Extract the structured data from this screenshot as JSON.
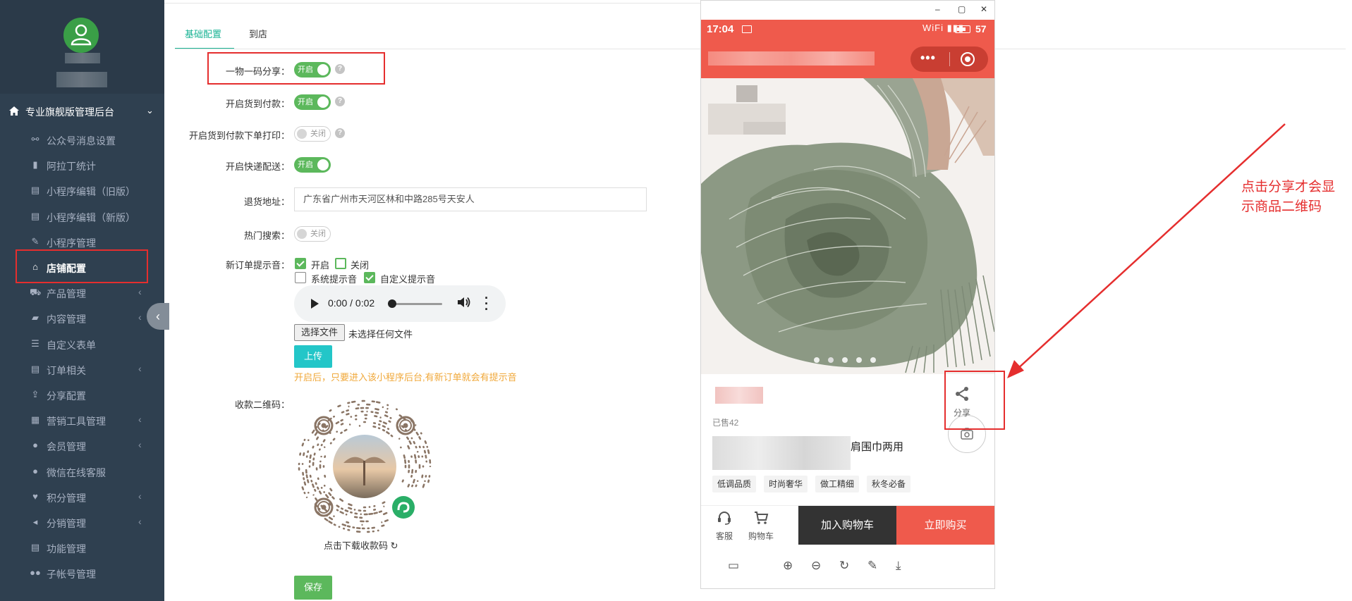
{
  "sidebar": {
    "header": {
      "label": "专业旗舰版管理后台",
      "icon": "home-icon",
      "chevron": "chevron-down-icon"
    },
    "items": [
      {
        "label": "公众号消息设置",
        "icon": "link-icon",
        "has_arrow": false,
        "active": false
      },
      {
        "label": "阿拉丁统计",
        "icon": "bar-chart-icon",
        "has_arrow": false,
        "active": false
      },
      {
        "label": "小程序编辑（旧版）",
        "icon": "book-icon",
        "has_arrow": false,
        "active": false
      },
      {
        "label": "小程序编辑（新版）",
        "icon": "book-icon",
        "has_arrow": false,
        "active": false
      },
      {
        "label": "小程序管理",
        "icon": "wrench-icon",
        "has_arrow": false,
        "active": false
      },
      {
        "label": "店铺配置",
        "icon": "home-icon",
        "has_arrow": false,
        "active": true
      },
      {
        "label": "产品管理",
        "icon": "cart-icon",
        "has_arrow": true,
        "active": false
      },
      {
        "label": "内容管理",
        "icon": "folder-icon",
        "has_arrow": true,
        "active": false
      },
      {
        "label": "自定义表单",
        "icon": "list-icon",
        "has_arrow": false,
        "active": false
      },
      {
        "label": "订单相关",
        "icon": "order-icon",
        "has_arrow": true,
        "active": false
      },
      {
        "label": "分享配置",
        "icon": "share-icon",
        "has_arrow": false,
        "active": false
      },
      {
        "label": "营销工具管理",
        "icon": "grid-icon",
        "has_arrow": true,
        "active": false
      },
      {
        "label": "会员管理",
        "icon": "user-icon",
        "has_arrow": true,
        "active": false
      },
      {
        "label": "微信在线客服",
        "icon": "user-icon",
        "has_arrow": false,
        "active": false
      },
      {
        "label": "积分管理",
        "icon": "heart-icon",
        "has_arrow": true,
        "active": false
      },
      {
        "label": "分销管理",
        "icon": "bullhorn-icon",
        "has_arrow": true,
        "active": false
      },
      {
        "label": "功能管理",
        "icon": "book-icon",
        "has_arrow": false,
        "active": false
      },
      {
        "label": "子帐号管理",
        "icon": "users-icon",
        "has_arrow": false,
        "active": false
      }
    ]
  },
  "tabs": [
    {
      "label": "基础配置",
      "active": true
    },
    {
      "label": "到店",
      "active": false
    }
  ],
  "form": {
    "share_one_code": {
      "label": "一物一码分享：",
      "toggle": "开启",
      "on": true
    },
    "cod": {
      "label": "开启货到付款：",
      "toggle": "开启",
      "on": true
    },
    "cod_print": {
      "label": "开启货到付款下单打印：",
      "toggle": "关闭",
      "on": false
    },
    "express": {
      "label": "开启快递配送：",
      "toggle": "开启",
      "on": true
    },
    "return_address": {
      "label": "退货地址：",
      "value": "广东省广州市天河区林和中路285号天安人"
    },
    "hot_search": {
      "label": "热门搜索：",
      "toggle": "关闭",
      "on": false
    },
    "order_sound": {
      "label": "新订单提示音：",
      "opt_on": "开启",
      "opt_off": "关闭",
      "opt_system": "系统提示音",
      "opt_custom": "自定义提示音",
      "audio_time": "0:00 / 0:02",
      "file_button": "选择文件",
      "file_status": "未选择任何文件",
      "upload": "上传",
      "hint": "开启后，只要进入该小程序后台,有新订单就会有提示音"
    },
    "qr": {
      "label": "收款二维码：",
      "caption": "点击下载收款码 ↻"
    },
    "save": "保存",
    "help_mark": "?"
  },
  "phone": {
    "window_controls": [
      "–",
      "▢",
      "✕"
    ],
    "time": "17:04",
    "battery": "57",
    "signal": "WiFi ▮▮▮",
    "nav_dots": "•••",
    "share_label": "分享",
    "sold": "已售42",
    "title_suffix": "肩围巾两用",
    "tags": [
      "低调品质",
      "时尚奢华",
      "做工精细",
      "秋冬必备"
    ],
    "bottom": {
      "service": "客服",
      "cart": "购物车",
      "add_cart": "加入购物车",
      "buy_now": "立即购买"
    },
    "colors": {
      "brand": "#ef5a4c",
      "dark": "#333333"
    }
  },
  "annotation": "点击分享才会显示商品二维码",
  "colors": {
    "sidebar_bg": "#2f4050",
    "accent": "#1ab394",
    "switch_on": "#5cb85c",
    "highlight": "#e52e2e"
  }
}
